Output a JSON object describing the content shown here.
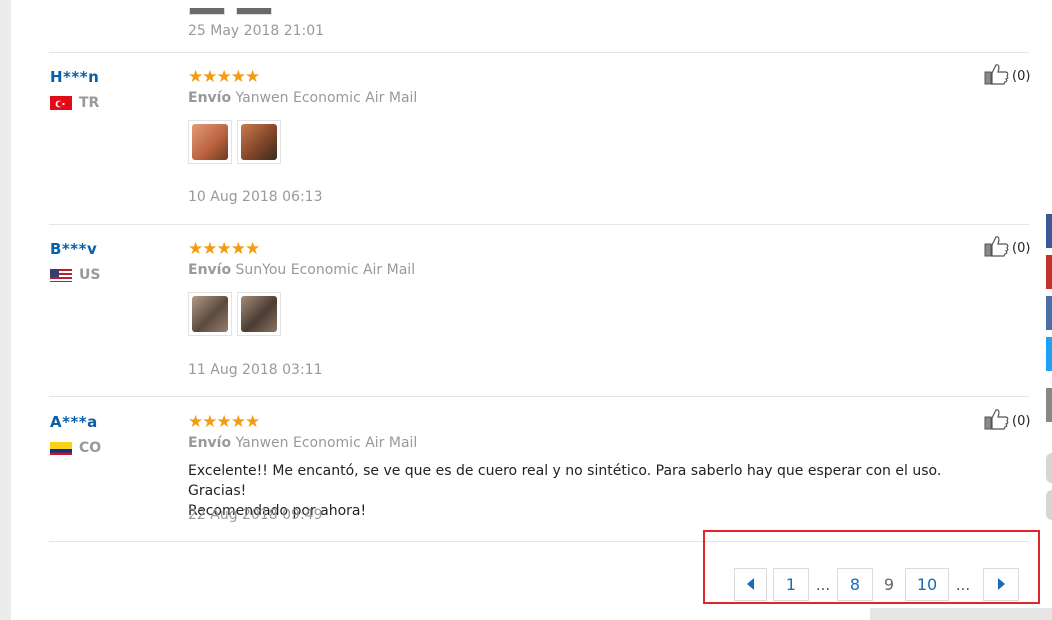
{
  "previous_review": {
    "date": "25 May 2018 21:01"
  },
  "reviews": [
    {
      "user": "H***n",
      "country_code": "TR",
      "country_flag_color": "#e30a17",
      "stars": "★★★★★",
      "shipping_label": "Envío",
      "shipping_method": "Yanwen Economic Air Mail",
      "text": "",
      "date": "10 Aug 2018 06:13",
      "helpful_count": "(0)",
      "thumb_colors": [
        "#c87a5a",
        "#8a4a2c"
      ]
    },
    {
      "user": "B***v",
      "country_code": "US",
      "country_flag_color": "#b22234",
      "stars": "★★★★★",
      "shipping_label": "Envío",
      "shipping_method": "SunYou Economic Air Mail",
      "text": "",
      "date": "11 Aug 2018 03:11",
      "helpful_count": "(0)",
      "thumb_colors": [
        "#8f7b6a",
        "#7a6656"
      ]
    },
    {
      "user": "A***a",
      "country_code": "CO",
      "country_flag_color": "#fcd116",
      "stars": "★★★★★",
      "shipping_label": "Envío",
      "shipping_method": "Yanwen Economic Air Mail",
      "text_line1": "Excelente!! Me encantó, se ve que es de cuero real y no sintético. Para saberlo hay que esperar con el uso. Gracias!",
      "text_line2": "Recomendado por ahora!",
      "date": "22 Aug 2018 09:49",
      "helpful_count": "(0)"
    }
  ],
  "icons": {
    "thumbs_up": "thumbs-up-icon",
    "prev": "prev-page-icon",
    "next": "next-page-icon"
  },
  "pagination": {
    "first": "1",
    "ellipsis_left": "...",
    "prev_near": "8",
    "current": "9",
    "next_near": "10",
    "ellipsis_right": "..."
  },
  "colors": {
    "accent_link": "#1a6cb8",
    "username": "#0a5fa8",
    "stars": "#f39c12",
    "highlight": "#e0262b",
    "social": [
      "#3b5998",
      "#c4302b",
      "#4a6ea8",
      "#1da1f2",
      "#888888"
    ]
  }
}
